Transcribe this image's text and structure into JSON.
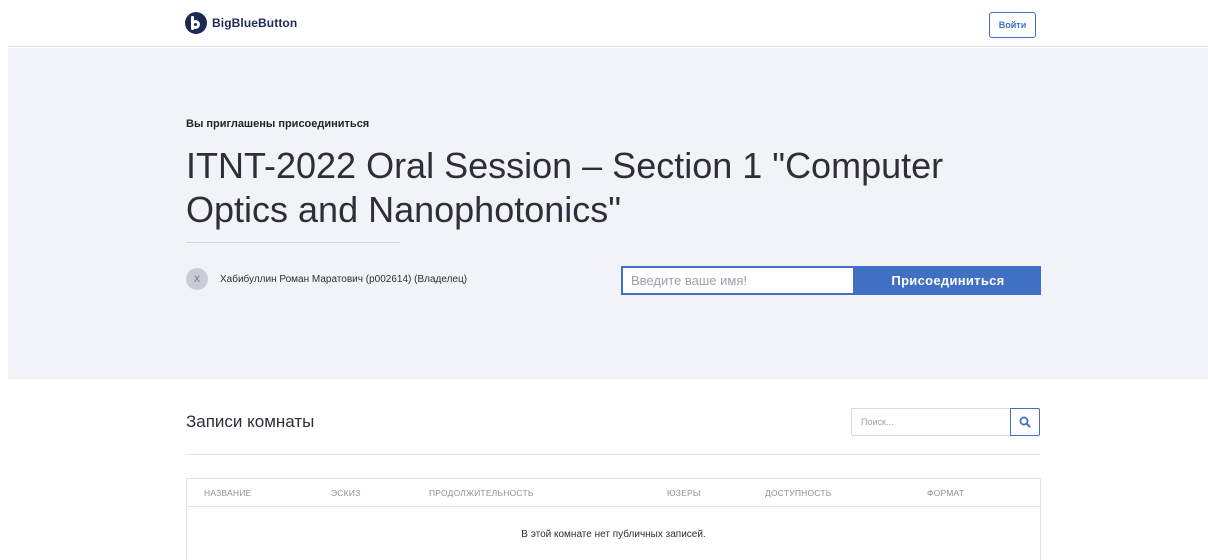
{
  "header": {
    "brand": "BigBlueButton",
    "signin_label": "Войти"
  },
  "hero": {
    "invited_label": "Вы приглашены присоединиться",
    "room_title": "ITNT-2022 Oral Session – Section 1 \"Computer Optics and Nanophotonics\"",
    "owner_initial": "X",
    "owner_name": "Хабибуллин Роман Маратович (p002614) (Владелец)",
    "name_input_placeholder": "Введите ваше имя!",
    "join_label": "Присоединиться"
  },
  "recordings": {
    "title": "Записи комнаты",
    "search_placeholder": "Поиск...",
    "columns": [
      "НАЗВАНИЕ",
      "ЭСКИЗ",
      "ПРОДОЛЖИТЕЛЬНОСТЬ",
      "ЮЗЕРЫ",
      "ДОСТУПНОСТЬ",
      "ФОРМАТ"
    ],
    "empty_message": "В этой комнате нет публичных записей."
  },
  "colors": {
    "accent": "#3f70c4",
    "hero_bg": "#f1f3f8",
    "brand_dark": "#1b2a57"
  }
}
